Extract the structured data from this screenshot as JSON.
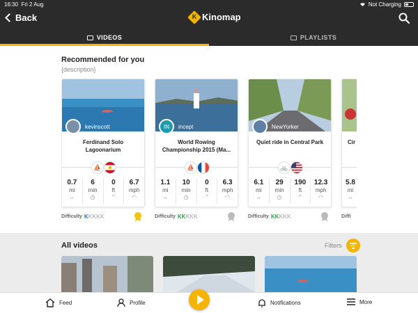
{
  "status_bar": {
    "time": "16:30",
    "date": "Fri 2 Aug",
    "charging": "Not Charging"
  },
  "header": {
    "back_label": "Back",
    "brand": "Kinomap"
  },
  "tabs": [
    {
      "label": "VIDEOS",
      "active": true
    },
    {
      "label": "PLAYLISTS",
      "active": false
    }
  ],
  "recommended": {
    "title": "Recommended for you",
    "description": "{description}"
  },
  "cards": [
    {
      "user": "kevinscott",
      "title": "Ferdinand Solo Lagoonarium",
      "sport_icon": "rowing-icon",
      "country": "French Polynesia",
      "stats": [
        {
          "value": "0.7",
          "unit": "mi"
        },
        {
          "value": "6",
          "unit": "min"
        },
        {
          "value": "0",
          "unit": "ft"
        },
        {
          "value": "6.7",
          "unit": "mph"
        }
      ],
      "difficulty_label": "Difficulty",
      "difficulty_level": 1,
      "medal": "gold"
    },
    {
      "user": "incept",
      "avatar_initials": "IN",
      "title": "World Rowing Championship 2015 (Ma...",
      "sport_icon": "rowing-icon",
      "country": "France",
      "stats": [
        {
          "value": "1.1",
          "unit": "mi"
        },
        {
          "value": "10",
          "unit": "min"
        },
        {
          "value": "0",
          "unit": "ft"
        },
        {
          "value": "6.3",
          "unit": "mph"
        }
      ],
      "difficulty_label": "Difficulty",
      "difficulty_level": 2,
      "medal": "silver"
    },
    {
      "user": "NewYorker",
      "title": "Quiet ride in Central Park",
      "sport_icon": "cycling-icon",
      "country": "United States",
      "stats": [
        {
          "value": "6.1",
          "unit": "mi"
        },
        {
          "value": "29",
          "unit": "min"
        },
        {
          "value": "190",
          "unit": "ft"
        },
        {
          "value": "12.3",
          "unit": "mph"
        }
      ],
      "difficulty_label": "Difficulty",
      "difficulty_level": 2,
      "medal": "silver"
    },
    {
      "title": "Cir",
      "stats": [
        {
          "value": "5.8",
          "unit": "mi"
        }
      ],
      "difficulty_label": "Diffi"
    }
  ],
  "all_videos": {
    "title": "All videos",
    "filters_label": "Filters"
  },
  "bottom_nav": {
    "feed": "Feed",
    "profile": "Profile",
    "notifications": "Notifications",
    "more": "More"
  },
  "colors": {
    "accent": "#f5b400",
    "bar": "#2b2b2b",
    "difficulty_blue": "#2a6fd6",
    "difficulty_green": "#2aa44a"
  }
}
